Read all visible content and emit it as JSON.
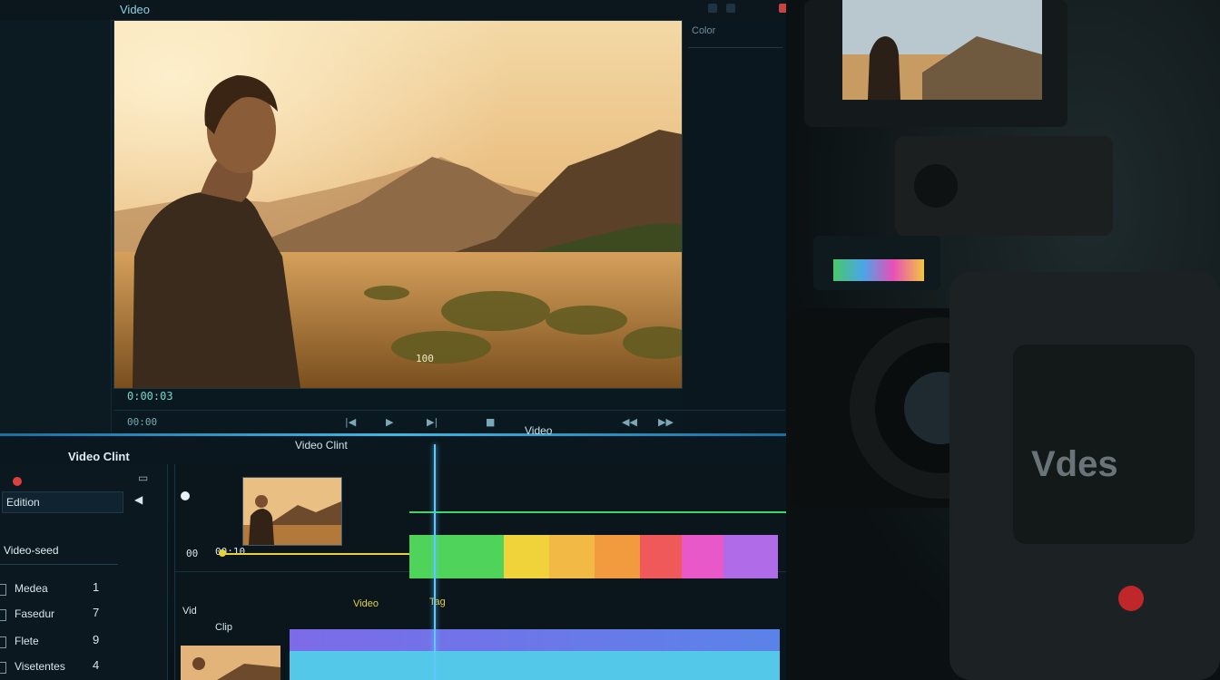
{
  "app": {
    "title": "Video"
  },
  "viewer": {
    "overlay_label": "100",
    "timecode": "0:00:03"
  },
  "sidebar_right": {
    "tab_label": "Color"
  },
  "transport": {
    "buttons": [
      "00:00",
      "|◀",
      "▶",
      "▶|",
      "■",
      "◀◀",
      "▶▶"
    ]
  },
  "timeline": {
    "left_title": "Video Clint",
    "center_title": "Video Clint",
    "right_title": "Video",
    "track1_time": "00:10",
    "track2_label_a": "Vid",
    "track2_label_b": "Clip",
    "track2_tags": [
      "Video",
      "Tag"
    ]
  },
  "panel": {
    "search_value": "Edition",
    "section_title": "Video-seed",
    "items": [
      {
        "label": "Medea",
        "count": "1"
      },
      {
        "label": "Fasedur",
        "count": "7"
      },
      {
        "label": "Flete",
        "count": "9"
      },
      {
        "label": "Visetentes",
        "count": "4"
      }
    ]
  },
  "colors": {
    "accent": "#3fb8e8",
    "green": "#4fd35a",
    "yellow": "#f0d23a",
    "orange": "#f19a3e",
    "red": "#f0595a",
    "magenta": "#e858c8",
    "purple": "#b06be8",
    "blue": "#4f8ae8",
    "cyan": "#54c8e8"
  },
  "camera": {
    "brand": "Vdes"
  }
}
